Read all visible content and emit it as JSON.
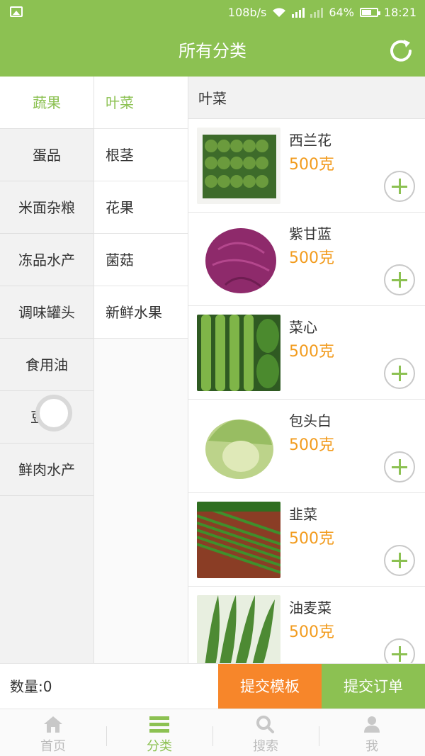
{
  "status_bar": {
    "network_speed": "108b/s",
    "battery": "64%",
    "time": "18:21"
  },
  "header": {
    "title": "所有分类"
  },
  "categories": [
    {
      "label": "蔬果",
      "active": true
    },
    {
      "label": "蛋品"
    },
    {
      "label": "米面杂粮"
    },
    {
      "label": "冻品水产"
    },
    {
      "label": "调味罐头"
    },
    {
      "label": "食用油"
    },
    {
      "label": "豆    品"
    },
    {
      "label": "鲜肉水产"
    }
  ],
  "subcategories": [
    {
      "label": "叶菜",
      "active": true
    },
    {
      "label": "根茎"
    },
    {
      "label": "花果"
    },
    {
      "label": "菌菇"
    },
    {
      "label": "新鲜水果"
    }
  ],
  "section_title": "叶菜",
  "products": [
    {
      "name": "西兰花",
      "price": "500克",
      "image": "broccoli"
    },
    {
      "name": "紫甘蓝",
      "price": "500克",
      "image": "red-cabbage"
    },
    {
      "name": "菜心",
      "price": "500克",
      "image": "choy-sum"
    },
    {
      "name": "包头白",
      "price": "500克",
      "image": "cabbage"
    },
    {
      "name": "韭菜",
      "price": "500克",
      "image": "chives"
    },
    {
      "name": "油麦菜",
      "price": "500克",
      "image": "lettuce"
    }
  ],
  "bottom_bar": {
    "quantity_label": "数量:0",
    "submit_template": "提交模板",
    "submit_order": "提交订单"
  },
  "tabs": [
    {
      "label": "首页",
      "icon": "home-icon"
    },
    {
      "label": "分类",
      "icon": "list-icon",
      "active": true
    },
    {
      "label": "搜索",
      "icon": "search-icon"
    },
    {
      "label": "我",
      "icon": "user-icon"
    }
  ],
  "colors": {
    "brand": "#8cc152",
    "price": "#f29b1d",
    "template_button": "#f7862a"
  }
}
